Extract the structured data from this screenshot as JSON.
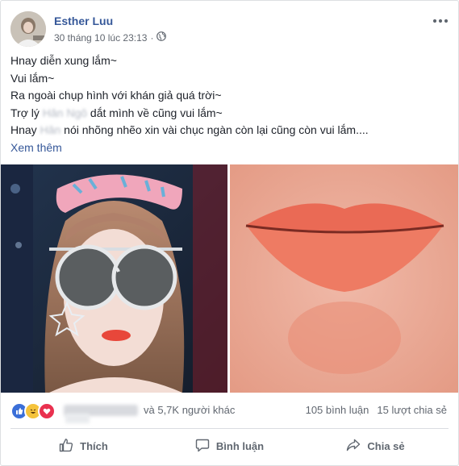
{
  "post": {
    "author": "Esther Luu",
    "timestamp": "30 tháng 10 lúc 23:13",
    "separator": "·",
    "audience_icon": "globe-icon",
    "more_icon": "ellipsis-icon",
    "lines": [
      {
        "text": "Hnay diễn xung lắm~"
      },
      {
        "text": "Vui lắm~"
      },
      {
        "text": "Ra ngoài chụp hình với khán giả quá trời~"
      },
      {
        "pre": "Trợ lý ",
        "blur": "Hân Ngô",
        "post": " dắt mình về cũng vui lắm~"
      },
      {
        "pre": "Hnay ",
        "blur": "Hân",
        "post": " nói nhõng nhẽo xin vài chục ngàn còn lại cũng còn vui lắm...."
      }
    ],
    "see_more": "Xem thêm",
    "photos": [
      "selfie-photo",
      "lips-closeup-photo"
    ]
  },
  "reactions": {
    "icons": [
      "like-icon",
      "haha-icon",
      "love-icon"
    ],
    "colors": {
      "like": "#3b6fd8",
      "haha": "#f5c33b",
      "love": "#e9314f"
    },
    "others": "và 5,7K người khác",
    "comments": "105 bình luận",
    "shares": "15 lượt chia sẻ"
  },
  "actions": {
    "like": "Thích",
    "comment": "Bình luận",
    "share": "Chia sẻ"
  },
  "colors": {
    "link": "#365899",
    "meta": "#616770",
    "text": "#1d2129"
  }
}
